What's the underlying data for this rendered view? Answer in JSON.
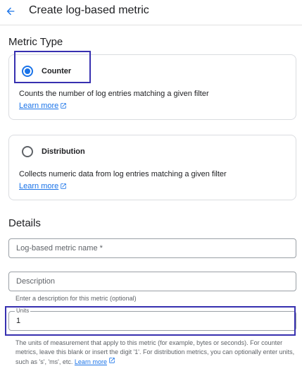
{
  "header": {
    "title": "Create log-based metric"
  },
  "metric_type": {
    "title": "Metric Type",
    "options": [
      {
        "label": "Counter",
        "selected": true,
        "description": "Counts the number of log entries matching a given filter",
        "link": "Learn more"
      },
      {
        "label": "Distribution",
        "selected": false,
        "description": "Collects numeric data from log entries matching a given filter",
        "link": "Learn more"
      }
    ]
  },
  "details": {
    "title": "Details",
    "name_field": {
      "placeholder": "Log-based metric name *",
      "value": ""
    },
    "description_field": {
      "placeholder": "Description",
      "value": "",
      "hint": "Enter a description for this metric (optional)"
    },
    "units_field": {
      "label": "Units",
      "value": "1",
      "help": "The units of measurement that apply to this metric (for example, bytes or seconds). For counter metrics, leave this blank or insert the digit '1'. For distribution metrics, you can optionally enter units, such as 's', 'ms', etc.",
      "help_link": "Learn more"
    }
  },
  "colors": {
    "accent": "#1a73e8",
    "highlight": "#3730b0"
  },
  "icons": {
    "back": "arrow-back-icon",
    "external": "open-in-new-icon"
  }
}
